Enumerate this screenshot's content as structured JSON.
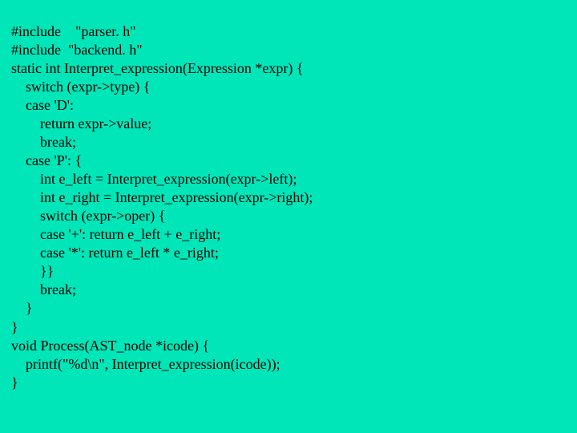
{
  "code": {
    "lines": [
      "#include    \"parser. h\"",
      "#include  \"backend. h\"",
      "static int Interpret_expression(Expression *expr) {",
      "    switch (expr->type) {",
      "    case 'D':",
      "        return expr->value;",
      "        break;",
      "    case 'P': {",
      "        int e_left = Interpret_expression(expr->left);",
      "        int e_right = Interpret_expression(expr->right);",
      "        switch (expr->oper) {",
      "        case '+': return e_left + e_right;",
      "        case '*': return e_left * e_right;",
      "        }}",
      "        break;",
      "    }",
      "}",
      "void Process(AST_node *icode) {",
      "    printf(\"%d\\n\", Interpret_expression(icode));",
      "}"
    ]
  }
}
